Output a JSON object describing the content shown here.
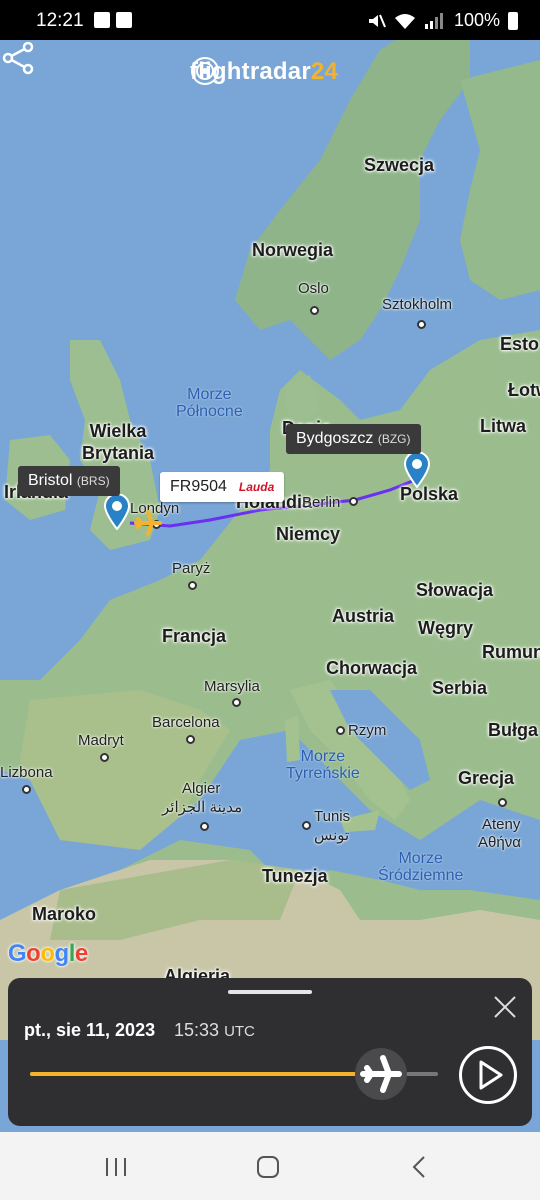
{
  "status_bar": {
    "time": "12:21",
    "battery": "100%",
    "icons": [
      "image-icon",
      "check-icon",
      "mute-icon",
      "wifi-icon",
      "signal-icon",
      "battery-icon"
    ]
  },
  "app": {
    "logo_text": "flightradar",
    "logo_suffix": "24",
    "accent_color": "#f4b32a"
  },
  "map": {
    "countries": {
      "szwecja": "Szwecja",
      "norwegia": "Norwegia",
      "esto": "Esto",
      "lotwa": "Łotw",
      "litwa": "Litwa",
      "wielka_brytania": "Wielka\nBrytania",
      "irlandia": "Irlandia",
      "dania": "Dania",
      "holandia": "Holandia",
      "polska": "Polska",
      "niemcy": "Niemcy",
      "francja": "Francja",
      "austria": "Austria",
      "slowacja": "Słowacja",
      "wegry": "Węgry",
      "rumun": "Rumun",
      "chorwacja": "Chorwacja",
      "serbia": "Serbia",
      "bulga": "Bułga",
      "grecja": "Grecja",
      "tunezja": "Tunezja",
      "maroko": "Maroko",
      "algieria": "Algieria"
    },
    "cities": {
      "oslo": "Oslo",
      "sztokholm": "Sztokholm",
      "londyn": "Londyn",
      "berlin": "Berlin",
      "paryz": "Paryż",
      "marsylia": "Marsylia",
      "barcelona": "Barcelona",
      "madryt": "Madryt",
      "lizbona": "Lizbona",
      "rzym": "Rzym",
      "algier": "Algier",
      "algier_ar": "مدينة الجزائر",
      "tunis": "Tunis",
      "tunis_ar": "تونس",
      "ateny": "Ateny",
      "ateny_gr": "Αθήνα"
    },
    "seas": {
      "polnocne": "Morze\nPółnocne",
      "tyrrenskie": "Morze\nTyrreńskie",
      "srodziemne": "Morze\nŚródziemne"
    },
    "airport_origin": {
      "name": "Bristol",
      "code": "(BRS)"
    },
    "airport_dest": {
      "name": "Bydgoszcz",
      "code": "(BZG)"
    },
    "flight": {
      "number": "FR9504",
      "airline_logo": "Lauda"
    },
    "attribution": "Google"
  },
  "playback": {
    "date": "pt., sie 11, 2023",
    "time": "15:33",
    "timezone": "UTC",
    "progress": 0.86
  }
}
